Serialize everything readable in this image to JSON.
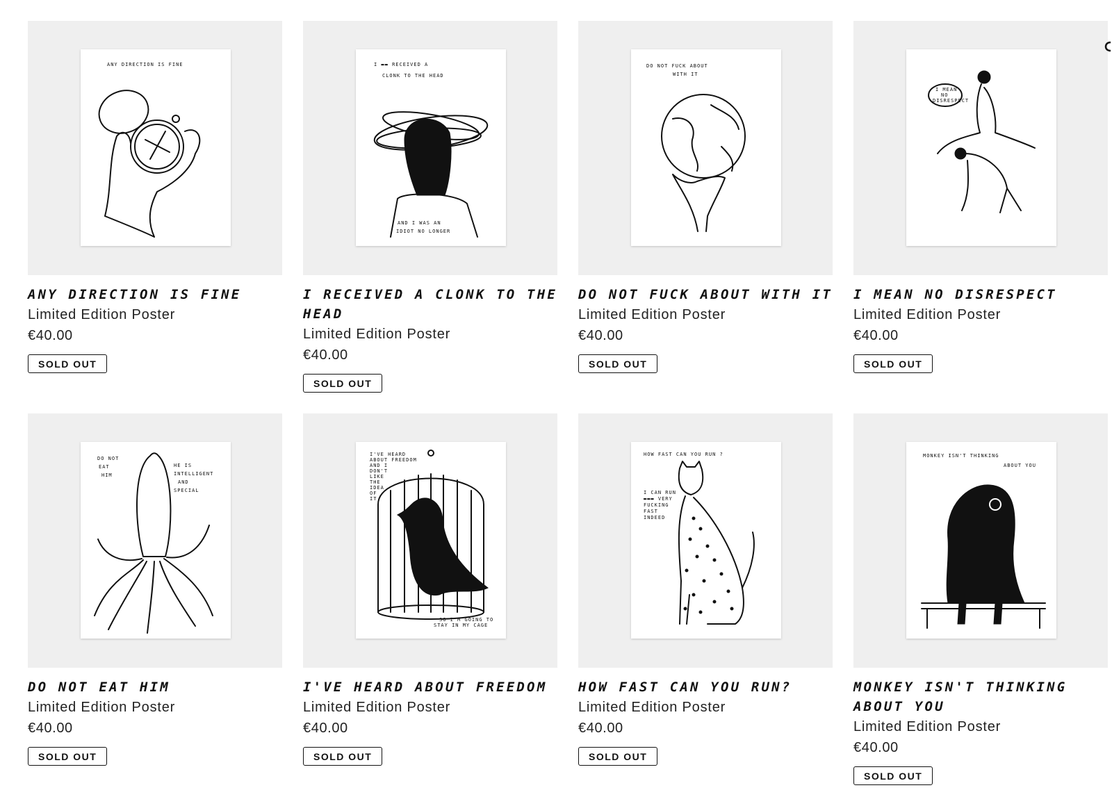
{
  "products": [
    {
      "title": "ANY DIRECTION IS FINE",
      "subtitle": "Limited Edition Poster",
      "price": "€40.00",
      "status": "SOLD OUT",
      "poster_text": [
        "ANY DIRECTION IS FINE"
      ],
      "icon": "compass-hand-illustration"
    },
    {
      "title": "I RECEIVED A CLONK TO THE HEAD",
      "subtitle": "Limited Edition Poster",
      "price": "€40.00",
      "status": "SOLD OUT",
      "poster_text": [
        "I ▬▬ RECEIVED A",
        "CLONK TO THE HEAD",
        "AND I WAS AN",
        "IDIOT NO LONGER"
      ],
      "icon": "dizzy-head-illustration"
    },
    {
      "title": "DO NOT FUCK ABOUT WITH IT",
      "subtitle": "Limited Edition Poster",
      "price": "€40.00",
      "status": "SOLD OUT",
      "poster_text": [
        "DO NOT FUCK ABOUT",
        "WITH IT"
      ],
      "icon": "globe-hand-illustration"
    },
    {
      "title": "I MEAN NO DISRESPECT",
      "subtitle": "Limited Edition Poster",
      "price": "€40.00",
      "status": "SOLD OUT",
      "poster_text": [
        "I MEAN",
        "NO",
        "DISRESPECT"
      ],
      "icon": "leapfrog-illustration"
    },
    {
      "title": "DO NOT EAT HIM",
      "subtitle": "Limited Edition Poster",
      "price": "€40.00",
      "status": "SOLD OUT",
      "poster_text": [
        "DO NOT",
        "EAT",
        "HIM",
        "HE IS",
        "INTELLIGENT",
        "AND",
        "SPECIAL"
      ],
      "icon": "squid-illustration"
    },
    {
      "title": "I'VE HEARD ABOUT FREEDOM",
      "subtitle": "Limited Edition Poster",
      "price": "€40.00",
      "status": "SOLD OUT",
      "poster_text": [
        "I'VE HEARD",
        "ABOUT FREEDOM",
        "AND I",
        "DON'T",
        "LIKE",
        "THE",
        "IDEA",
        "OF",
        "IT",
        "SO I'M GOING TO",
        "STAY IN MY CAGE"
      ],
      "icon": "caged-bird-illustration"
    },
    {
      "title": "HOW FAST CAN YOU RUN?",
      "subtitle": "Limited Edition Poster",
      "price": "€40.00",
      "status": "SOLD OUT",
      "poster_text": [
        "HOW FAST CAN YOU RUN ?",
        "I CAN RUN",
        "▬▬▬ VERY",
        "FUCKING",
        "FAST",
        "INDEED"
      ],
      "icon": "cheetah-illustration"
    },
    {
      "title": "MONKEY ISN'T THINKING ABOUT YOU",
      "subtitle": "Limited Edition Poster",
      "price": "€40.00",
      "status": "SOLD OUT",
      "poster_text": [
        "MONKEY ISN'T THINKING",
        "ABOUT YOU"
      ],
      "icon": "monkey-illustration"
    }
  ]
}
